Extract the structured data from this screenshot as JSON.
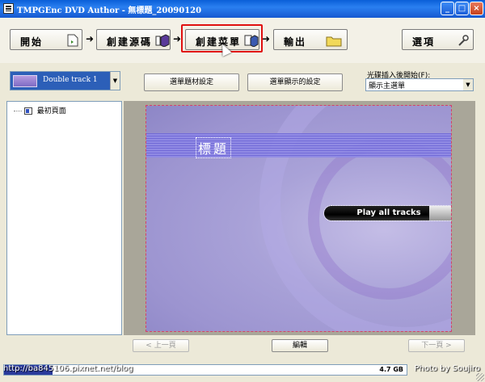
{
  "window": {
    "title": "TMPGEnc DVD Author - 無標題_20090120",
    "minimize": "_",
    "maximize": "□",
    "close": "×"
  },
  "steps": {
    "start": "開始",
    "source": "創建源碼",
    "menu": "創建菜單",
    "output": "輸出",
    "options": "選項",
    "arrow": "➜"
  },
  "controls": {
    "track_name": "Double track 1",
    "menu_material": "選單題材設定",
    "menu_display": "選單顯示的設定",
    "start_label": "光碟插入後開始(F):",
    "start_value": "顯示主選單"
  },
  "tree": {
    "root": "最初頁面"
  },
  "preview": {
    "title": "標題",
    "play_all": "Play all tracks"
  },
  "nav": {
    "prev": "< 上一頁",
    "edit": "編輯",
    "next": "下一頁 >"
  },
  "status": {
    "disk_fraction": 0.12,
    "disk_size": "4.7 GB",
    "url": "http://ba845106.pixnet.net/blog",
    "credit": "Photo by Soujiro"
  },
  "colors": {
    "highlight": "#e01010",
    "titlebar": "#0a5fd8"
  }
}
